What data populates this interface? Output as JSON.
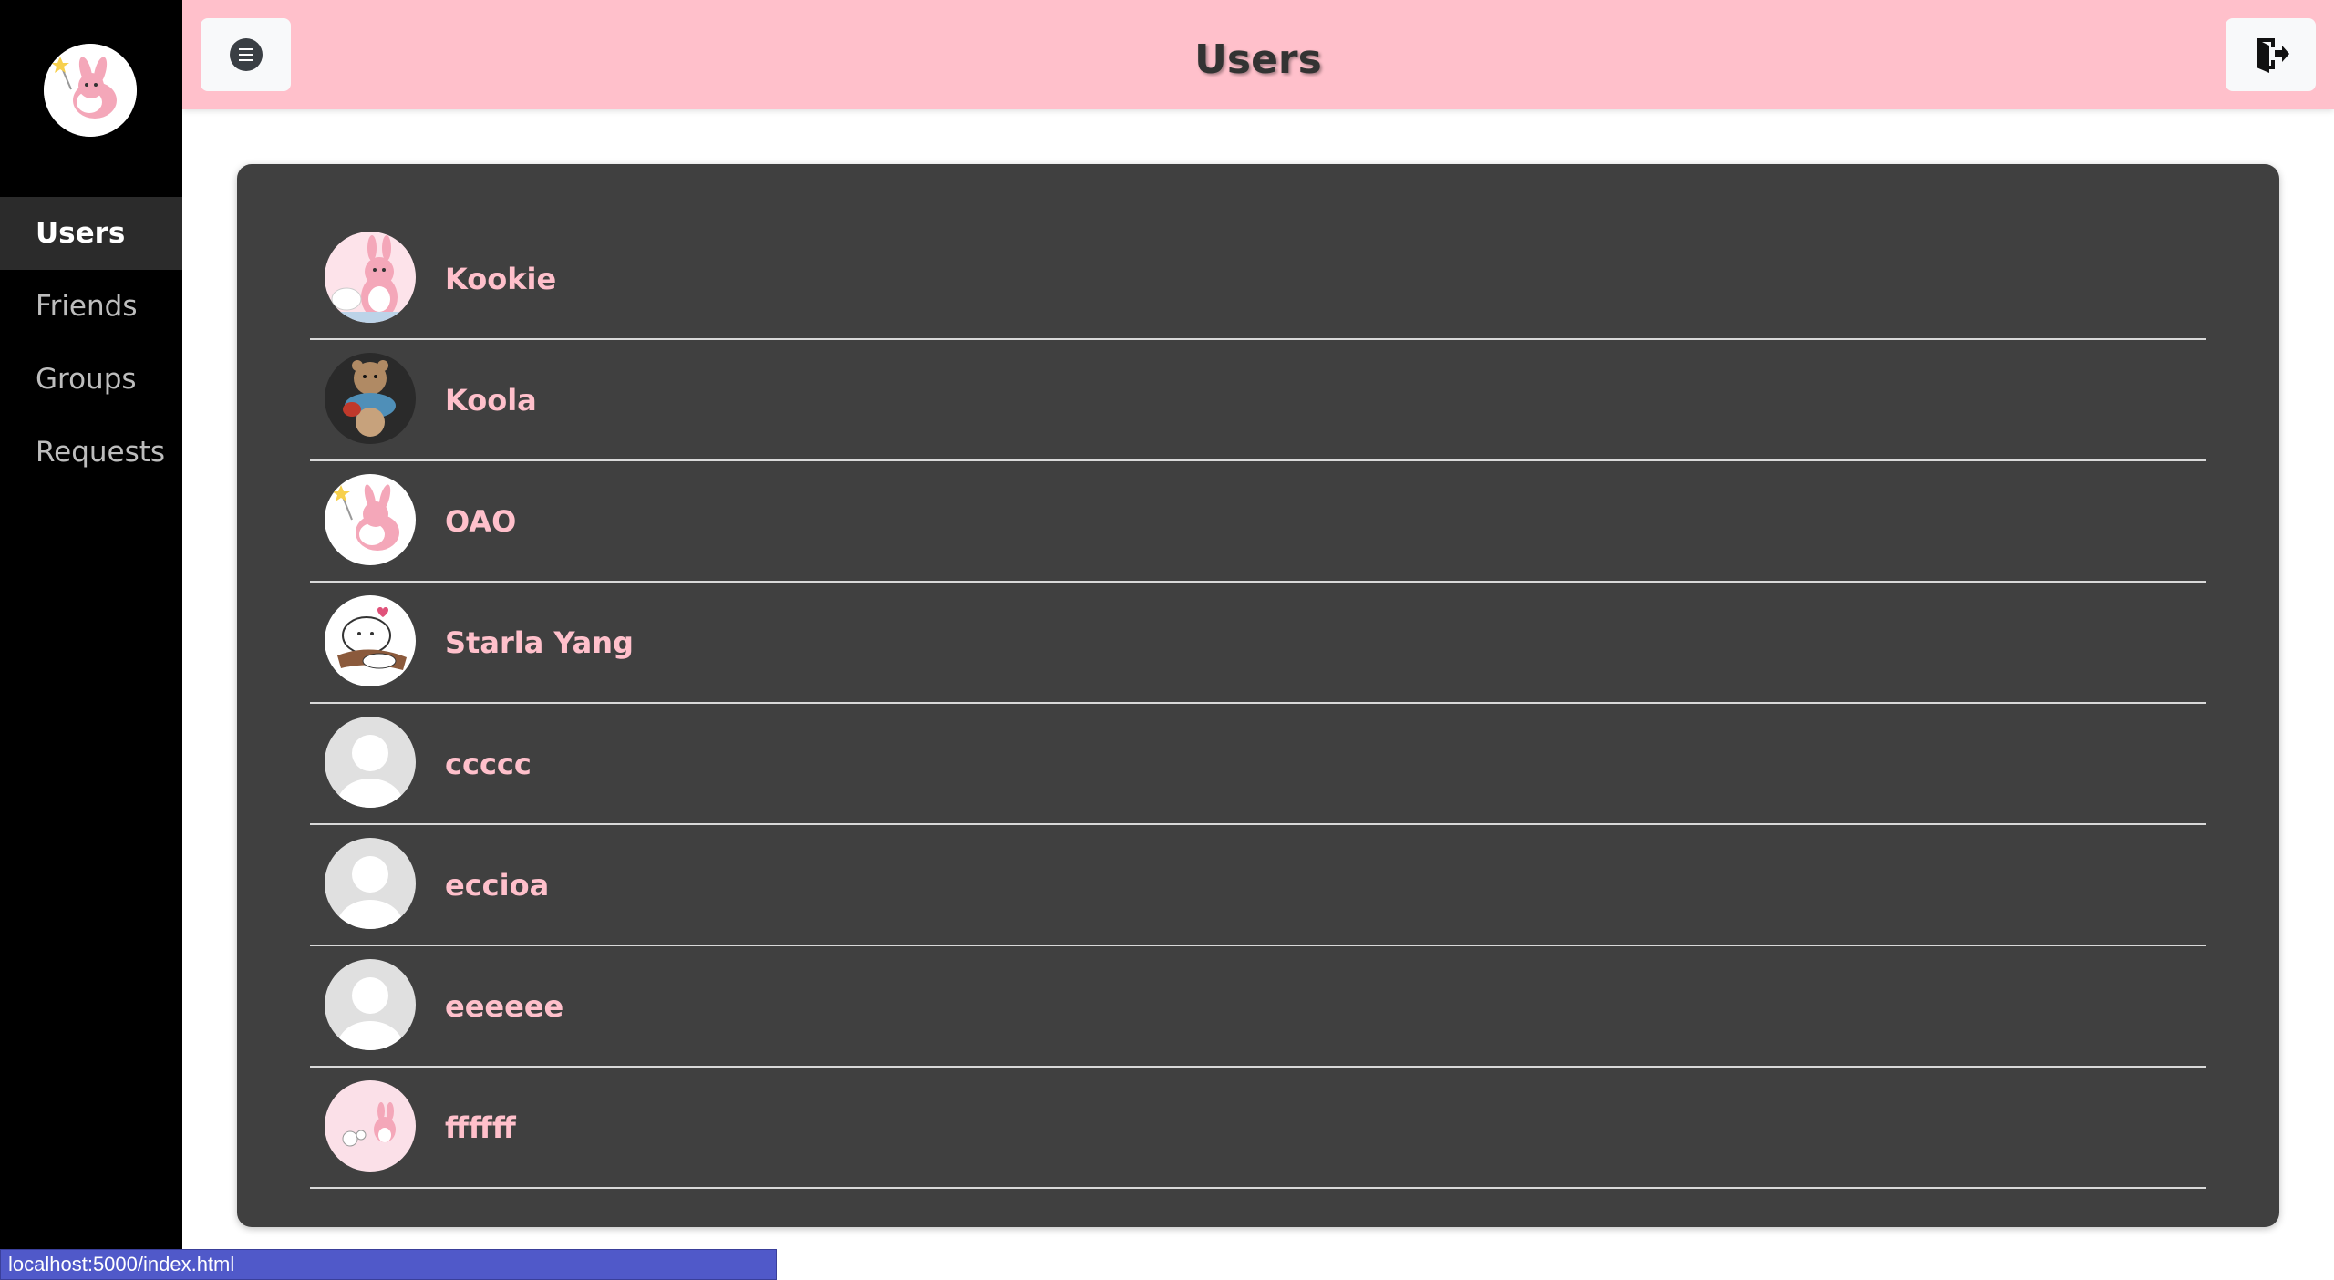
{
  "header": {
    "title": "Users"
  },
  "sidebar": {
    "items": [
      {
        "label": "Users",
        "active": true
      },
      {
        "label": "Friends",
        "active": false
      },
      {
        "label": "Groups",
        "active": false
      },
      {
        "label": "Requests",
        "active": false
      }
    ]
  },
  "users": [
    {
      "name": "Kookie",
      "avatar": "pink-bunny-avatar"
    },
    {
      "name": "Koola",
      "avatar": "teddy-bear-avatar"
    },
    {
      "name": "OAO",
      "avatar": "bunny-wand-avatar"
    },
    {
      "name": "Starla Yang",
      "avatar": "white-creature-avatar"
    },
    {
      "name": "ccccc",
      "avatar": "default-avatar"
    },
    {
      "name": "eccioa",
      "avatar": "default-avatar"
    },
    {
      "name": "eeeeee",
      "avatar": "default-avatar"
    },
    {
      "name": "ffffff",
      "avatar": "pink-bunny-small-avatar"
    }
  ],
  "status_bar": {
    "url": "localhost:5000/index.html"
  },
  "colors": {
    "header_bg": "#ffc0cb",
    "sidebar_bg": "#000000",
    "card_bg": "#404040",
    "username": "#ffc0cb"
  }
}
